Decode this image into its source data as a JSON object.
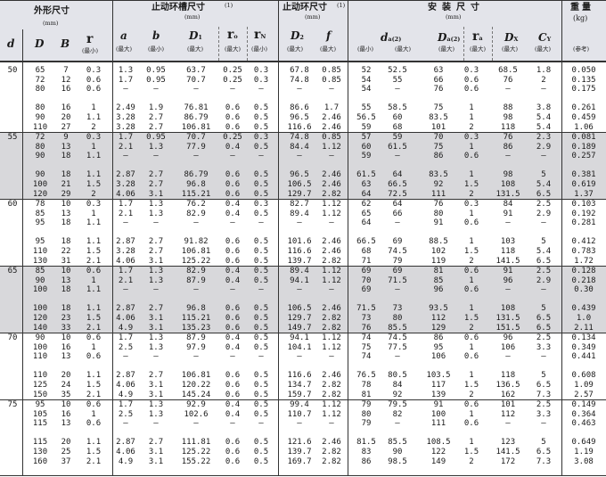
{
  "header": {
    "group_outer": "外形尺寸",
    "group_outer_unit": "(mm)",
    "group_groove": "止动环槽尺寸",
    "group_groove_note": "(1)",
    "group_groove_unit": "(mm)",
    "group_ring": "止动环尺寸",
    "group_ring_note": "(1)",
    "group_ring_unit": "(mm)",
    "group_mount": "安装尺寸",
    "group_mount_unit": "(mm)",
    "group_weight": "重量",
    "group_weight_unit": "(kg)",
    "col_d": "d",
    "col_D": "D",
    "col_B": "B",
    "col_r": "r",
    "col_r_note": "(最小)",
    "col_a": "a",
    "col_b": "b",
    "col_D1": "D",
    "col_D1_sub": "1",
    "col_ro": "r",
    "col_ro_sub": "o",
    "col_rN": "r",
    "col_rN_sub": "N",
    "col_D2": "D",
    "col_D2_sub": "2",
    "col_f": "f",
    "col_da": "d",
    "col_da_sub": "a",
    "col_da_note": "(2)",
    "col_Da": "D",
    "col_Da_sub": "a",
    "col_Da_note": "(2)",
    "col_ra": "r",
    "col_ra_sub": "a",
    "col_DX": "D",
    "col_DX_sub": "X",
    "col_CY": "C",
    "col_CY_sub": "Y",
    "lbl_max": "(最大)",
    "lbl_min": "(最小)",
    "lbl_ref": "(参考)"
  },
  "groups": [
    {
      "d": "50",
      "D": [
        "65",
        "72",
        "80",
        "",
        "80",
        "90",
        "110"
      ],
      "B": [
        "7",
        "12",
        "16",
        "",
        "16",
        "20",
        "27"
      ],
      "r": [
        "0.3",
        "0.6",
        "0.6",
        "",
        "1",
        "1.1",
        "2"
      ],
      "a": [
        "1.3",
        "1.7",
        "—",
        "",
        "2.49",
        "3.28",
        "3.28"
      ],
      "b": [
        "0.95",
        "0.95",
        "—",
        "",
        "1.9",
        "2.7",
        "2.7"
      ],
      "D1": [
        "63.7",
        "70.7",
        "—",
        "",
        "76.81",
        "86.79",
        "106.81"
      ],
      "ro": [
        "0.25",
        "0.25",
        "—",
        "",
        "0.6",
        "0.6",
        "0.6"
      ],
      "rN": [
        "0.3",
        "0.3",
        "—",
        "",
        "0.5",
        "0.5",
        "0.5"
      ],
      "D2": [
        "67.8",
        "74.8",
        "—",
        "",
        "86.6",
        "96.5",
        "116.6"
      ],
      "f": [
        "0.85",
        "0.85",
        "—",
        "",
        "1.7",
        "2.46",
        "2.46"
      ],
      "da1": [
        "52",
        "54",
        "54",
        "",
        "55",
        "56.5",
        "59"
      ],
      "da2": [
        "52.5",
        "55",
        "—",
        "",
        "58.5",
        "60",
        "68"
      ],
      "Da": [
        "63",
        "66",
        "76",
        "",
        "75",
        "83.5",
        "101"
      ],
      "ra": [
        "0.3",
        "0.6",
        "0.6",
        "",
        "1",
        "1",
        "2"
      ],
      "DX": [
        "68.5",
        "76",
        "—",
        "",
        "88",
        "98",
        "118"
      ],
      "CY": [
        "1.8",
        "2",
        "—",
        "",
        "3.8",
        "5.4",
        "5.4"
      ],
      "w": [
        "0.050",
        "0.135",
        "0.175",
        "",
        "0.261",
        "0.459",
        "1.06"
      ]
    },
    {
      "d": "55",
      "D": [
        "72",
        "80",
        "90",
        "",
        "90",
        "100",
        "120"
      ],
      "B": [
        "9",
        "13",
        "18",
        "",
        "18",
        "21",
        "29"
      ],
      "r": [
        "0.3",
        "1",
        "1.1",
        "",
        "1.1",
        "1.5",
        "2"
      ],
      "a": [
        "1.7",
        "2.1",
        "—",
        "",
        "2.87",
        "3.28",
        "4.06"
      ],
      "b": [
        "0.95",
        "1.3",
        "—",
        "",
        "2.7",
        "2.7",
        "3.1"
      ],
      "D1": [
        "70.7",
        "77.9",
        "—",
        "",
        "86.79",
        "96.8",
        "115.21"
      ],
      "ro": [
        "0.25",
        "0.4",
        "—",
        "",
        "0.6",
        "0.6",
        "0.6"
      ],
      "rN": [
        "0.3",
        "0.5",
        "—",
        "",
        "0.5",
        "0.5",
        "0.5"
      ],
      "D2": [
        "74.8",
        "84.4",
        "—",
        "",
        "96.5",
        "106.5",
        "129.7"
      ],
      "f": [
        "0.85",
        "1.12",
        "—",
        "",
        "2.46",
        "2.46",
        "2.82"
      ],
      "da1": [
        "57",
        "60",
        "59",
        "",
        "61.5",
        "63",
        "64"
      ],
      "da2": [
        "59",
        "61.5",
        "—",
        "",
        "64",
        "66.5",
        "72.5"
      ],
      "Da": [
        "70",
        "75",
        "86",
        "",
        "83.5",
        "92",
        "111"
      ],
      "ra": [
        "0.3",
        "1",
        "0.6",
        "",
        "1",
        "1.5",
        "2"
      ],
      "DX": [
        "76",
        "86",
        "—",
        "",
        "98",
        "108",
        "131.5"
      ],
      "CY": [
        "2.3",
        "2.9",
        "—",
        "",
        "5",
        "5.4",
        "6.5"
      ],
      "w": [
        "0.081",
        "0.189",
        "0.257",
        "",
        "0.381",
        "0.619",
        "1.37"
      ]
    },
    {
      "d": "60",
      "D": [
        "78",
        "85",
        "95",
        "",
        "95",
        "110",
        "130"
      ],
      "B": [
        "10",
        "13",
        "18",
        "",
        "18",
        "22",
        "31"
      ],
      "r": [
        "0.3",
        "1",
        "1.1",
        "",
        "1.1",
        "1.5",
        "2.1"
      ],
      "a": [
        "1.7",
        "2.1",
        "—",
        "",
        "2.87",
        "3.28",
        "4.06"
      ],
      "b": [
        "1.3",
        "1.3",
        "—",
        "",
        "2.7",
        "2.7",
        "3.1"
      ],
      "D1": [
        "76.2",
        "82.9",
        "—",
        "",
        "91.82",
        "106.81",
        "125.22"
      ],
      "ro": [
        "0.4",
        "0.4",
        "—",
        "",
        "0.6",
        "0.6",
        "0.6"
      ],
      "rN": [
        "0.3",
        "0.5",
        "—",
        "",
        "0.5",
        "0.5",
        "0.5"
      ],
      "D2": [
        "82.7",
        "89.4",
        "—",
        "",
        "101.6",
        "116.6",
        "139.7"
      ],
      "f": [
        "1.12",
        "1.12",
        "—",
        "",
        "2.46",
        "2.46",
        "2.82"
      ],
      "da1": [
        "62",
        "65",
        "64",
        "",
        "66.5",
        "68",
        "71"
      ],
      "da2": [
        "64",
        "66",
        "—",
        "",
        "69",
        "74.5",
        "79"
      ],
      "Da": [
        "76",
        "80",
        "91",
        "",
        "88.5",
        "102",
        "119"
      ],
      "ra": [
        "0.3",
        "1",
        "0.6",
        "",
        "1",
        "1.5",
        "2"
      ],
      "DX": [
        "84",
        "91",
        "—",
        "",
        "103",
        "118",
        "141.5"
      ],
      "CY": [
        "2.5",
        "2.9",
        "—",
        "",
        "5",
        "5.4",
        "6.5"
      ],
      "w": [
        "0.103",
        "0.192",
        "0.281",
        "",
        "0.412",
        "0.783",
        "1.72"
      ]
    },
    {
      "d": "65",
      "D": [
        "85",
        "90",
        "100",
        "",
        "100",
        "120",
        "140"
      ],
      "B": [
        "10",
        "13",
        "18",
        "",
        "18",
        "23",
        "33"
      ],
      "r": [
        "0.6",
        "1",
        "1.1",
        "",
        "1.1",
        "1.5",
        "2.1"
      ],
      "a": [
        "1.7",
        "2.1",
        "—",
        "",
        "2.87",
        "4.06",
        "4.9"
      ],
      "b": [
        "1.3",
        "1.3",
        "—",
        "",
        "2.7",
        "3.1",
        "3.1"
      ],
      "D1": [
        "82.9",
        "87.9",
        "—",
        "",
        "96.8",
        "115.21",
        "135.23"
      ],
      "ro": [
        "0.4",
        "0.4",
        "—",
        "",
        "0.6",
        "0.6",
        "0.6"
      ],
      "rN": [
        "0.5",
        "0.5",
        "—",
        "",
        "0.5",
        "0.5",
        "0.5"
      ],
      "D2": [
        "89.4",
        "94.1",
        "—",
        "",
        "106.5",
        "129.7",
        "149.7"
      ],
      "f": [
        "1.12",
        "1.12",
        "—",
        "",
        "2.46",
        "2.82",
        "2.82"
      ],
      "da1": [
        "69",
        "70",
        "69",
        "",
        "71.5",
        "73",
        "76"
      ],
      "da2": [
        "69",
        "71.5",
        "—",
        "",
        "73",
        "80",
        "85.5"
      ],
      "Da": [
        "81",
        "85",
        "96",
        "",
        "93.5",
        "112",
        "129"
      ],
      "ra": [
        "0.6",
        "1",
        "0.6",
        "",
        "1",
        "1.5",
        "2"
      ],
      "DX": [
        "91",
        "96",
        "—",
        "",
        "108",
        "131.5",
        "151.5"
      ],
      "CY": [
        "2.5",
        "2.9",
        "—",
        "",
        "5",
        "6.5",
        "6.5"
      ],
      "w": [
        "0.128",
        "0.218",
        "0.30",
        "",
        "0.439",
        "1.0",
        "2.11"
      ]
    },
    {
      "d": "70",
      "D": [
        "90",
        "100",
        "110",
        "",
        "110",
        "125",
        "150"
      ],
      "B": [
        "10",
        "16",
        "13",
        "",
        "20",
        "24",
        "35"
      ],
      "r": [
        "0.6",
        "1",
        "0.6",
        "",
        "1.1",
        "1.5",
        "2.1"
      ],
      "a": [
        "1.7",
        "2.5",
        "—",
        "",
        "2.87",
        "4.06",
        "4.9"
      ],
      "b": [
        "1.3",
        "1.3",
        "—",
        "",
        "2.7",
        "3.1",
        "3.1"
      ],
      "D1": [
        "87.9",
        "97.9",
        "—",
        "",
        "106.81",
        "120.22",
        "145.24"
      ],
      "ro": [
        "0.4",
        "0.4",
        "—",
        "",
        "0.6",
        "0.6",
        "0.6"
      ],
      "rN": [
        "0.5",
        "0.5",
        "—",
        "",
        "0.5",
        "0.5",
        "0.5"
      ],
      "D2": [
        "94.1",
        "104.1",
        "—",
        "",
        "116.6",
        "134.7",
        "159.7"
      ],
      "f": [
        "1.12",
        "1.12",
        "—",
        "",
        "2.46",
        "2.82",
        "2.82"
      ],
      "da1": [
        "74",
        "75",
        "74",
        "",
        "76.5",
        "78",
        "81"
      ],
      "da2": [
        "74.5",
        "77.5",
        "—",
        "",
        "80.5",
        "84",
        "92"
      ],
      "Da": [
        "86",
        "95",
        "106",
        "",
        "103.5",
        "117",
        "139"
      ],
      "ra": [
        "0.6",
        "1",
        "0.6",
        "",
        "1",
        "1.5",
        "2"
      ],
      "DX": [
        "96",
        "106",
        "—",
        "",
        "118",
        "136.5",
        "162"
      ],
      "CY": [
        "2.5",
        "3.3",
        "—",
        "",
        "5",
        "6.5",
        "7.3"
      ],
      "w": [
        "0.134",
        "0.349",
        "0.441",
        "",
        "0.608",
        "1.09",
        "2.57"
      ]
    },
    {
      "d": "75",
      "D": [
        "95",
        "105",
        "115",
        "",
        "115",
        "130",
        "160"
      ],
      "B": [
        "10",
        "16",
        "13",
        "",
        "20",
        "25",
        "37"
      ],
      "r": [
        "0.6",
        "1",
        "0.6",
        "",
        "1.1",
        "1.5",
        "2.1"
      ],
      "a": [
        "1.7",
        "2.5",
        "—",
        "",
        "2.87",
        "4.06",
        "4.9"
      ],
      "b": [
        "1.3",
        "1.3",
        "—",
        "",
        "2.7",
        "3.1",
        "3.1"
      ],
      "D1": [
        "92.9",
        "102.6",
        "—",
        "",
        "111.81",
        "125.22",
        "155.22"
      ],
      "ro": [
        "0.4",
        "0.4",
        "—",
        "",
        "0.6",
        "0.6",
        "0.6"
      ],
      "rN": [
        "0.5",
        "0.5",
        "—",
        "",
        "0.5",
        "0.5",
        "0.5"
      ],
      "D2": [
        "99.4",
        "110.7",
        "—",
        "",
        "121.6",
        "139.7",
        "169.7"
      ],
      "f": [
        "1.12",
        "1.12",
        "—",
        "",
        "2.46",
        "2.82",
        "2.82"
      ],
      "da1": [
        "79",
        "80",
        "79",
        "",
        "81.5",
        "83",
        "86"
      ],
      "da2": [
        "79.5",
        "82",
        "—",
        "",
        "85.5",
        "90",
        "98.5"
      ],
      "Da": [
        "91",
        "100",
        "111",
        "",
        "108.5",
        "122",
        "149"
      ],
      "ra": [
        "0.6",
        "1",
        "0.6",
        "",
        "1",
        "1.5",
        "2"
      ],
      "DX": [
        "101",
        "112",
        "—",
        "",
        "123",
        "141.5",
        "172"
      ],
      "CY": [
        "2.5",
        "3.3",
        "—",
        "",
        "5",
        "6.5",
        "7.3"
      ],
      "w": [
        "0.149",
        "0.364",
        "0.463",
        "",
        "0.649",
        "1.19",
        "3.08"
      ]
    }
  ]
}
